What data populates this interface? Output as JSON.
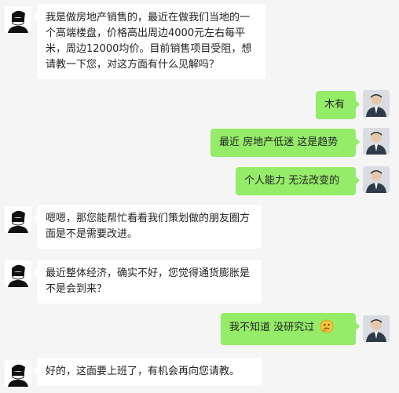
{
  "chat": {
    "messages": [
      {
        "side": "left",
        "text": "我是做房地产销售的，最近在做我们当地的一个高端楼盘，价格高出周边4000元左右每平米，周边12000均价。目前销售项目受阻，想请教一下您，对这方面有什么见解吗？"
      },
      {
        "side": "right",
        "text": "木有"
      },
      {
        "side": "right",
        "text": "最近 房地产低迷 这是趋势"
      },
      {
        "side": "right",
        "text": "个人能力 无法改变的"
      },
      {
        "side": "left",
        "text": "嗯嗯，那您能帮忙看看我们策划做的朋友圈方面是不是需要改进。"
      },
      {
        "side": "left",
        "text": "最近整体经济，确实不好，您觉得通货膨胀是不是会到来？"
      },
      {
        "side": "right",
        "text": "我不知道 没研究过",
        "emoji": "thinking-face-emoji"
      },
      {
        "side": "left",
        "text": "好的，这面要上班了，有机会再向您请教。"
      }
    ],
    "colors": {
      "background": "#f5f5f5",
      "left_bubble": "#ffffff",
      "right_bubble": "#95ec69"
    },
    "avatars": {
      "left": "masked-man-avatar",
      "right": "businessman-avatar"
    }
  }
}
